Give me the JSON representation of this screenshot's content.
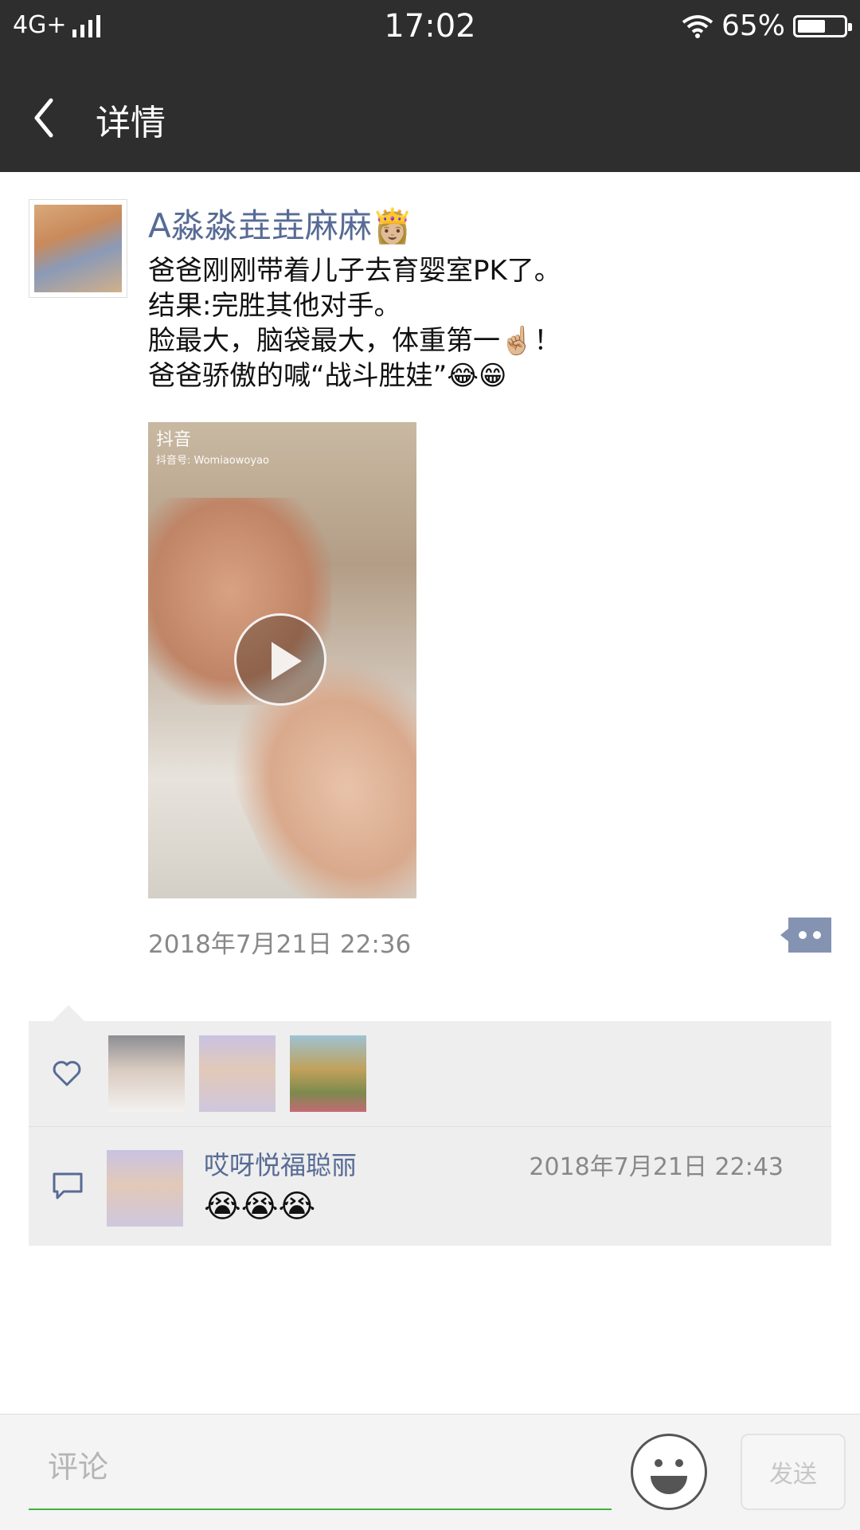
{
  "status_bar": {
    "network": "4G+",
    "time": "17:02",
    "battery_percent": "65%",
    "battery_level": 0.65
  },
  "nav": {
    "title": "详情"
  },
  "post": {
    "author": "A淼淼垚垚麻麻👸🏼",
    "text_lines": [
      "爸爸刚刚带着儿子去育婴室PK了。",
      "结果:完胜其他对手。",
      "脸最大，脑袋最大，体重第一☝🏼！",
      "爸爸骄傲的喊“战斗胜娃”😂😁"
    ],
    "video_watermark": "抖音",
    "video_watermark_id": "抖音号: Womiaowoyao",
    "timestamp": "2018年7月21日 22:36"
  },
  "comments": [
    {
      "author": "哎呀悦福聪丽",
      "time": "2018年7月21日 22:43",
      "text": "😭😭😭"
    }
  ],
  "input_bar": {
    "placeholder": "评论",
    "send_label": "发送"
  },
  "icons": {
    "like": "heart-icon",
    "comment": "comment-icon",
    "emoji": "smiley-icon",
    "back": "back-arrow-icon",
    "more": "more-dots-icon"
  },
  "colors": {
    "nav_bg": "#2e2e2e",
    "name_link": "#576b95",
    "input_underline": "#3fb23f",
    "social_bg": "#eeeeee"
  }
}
